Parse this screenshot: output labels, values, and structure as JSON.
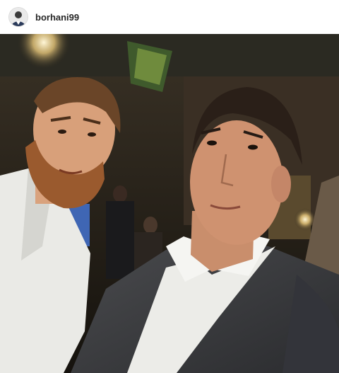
{
  "post": {
    "author": {
      "username": "borhani99",
      "avatar_icon": "profile-avatar"
    },
    "photo": {
      "subject": "selfie-photo"
    }
  }
}
